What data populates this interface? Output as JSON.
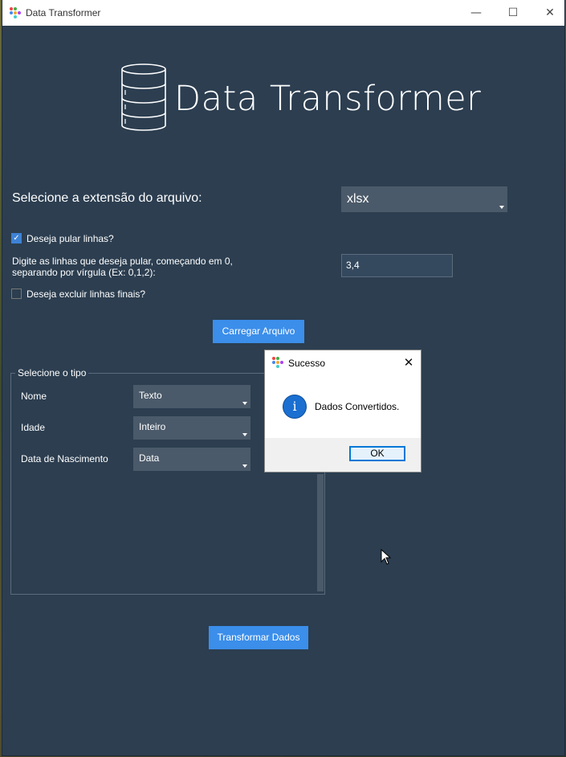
{
  "window": {
    "title": "Data Transformer"
  },
  "header": {
    "app_title": "Data Transformer"
  },
  "extension": {
    "label": "Selecione a extensão do arquivo:",
    "value": "xlsx"
  },
  "skip_lines": {
    "checked": true,
    "label": "Deseja pular linhas?",
    "instruction_line1": "Digite as linhas que deseja pular, começando em 0,",
    "instruction_line2": "separando por vírgula (Ex: 0,1,2):",
    "value": "3,4"
  },
  "exclude_final": {
    "checked": false,
    "label": "Deseja excluir linhas finais?"
  },
  "load_button": "Carregar Arquivo",
  "types_group": {
    "title": "Selecione o tipo",
    "rows": [
      {
        "column": "Nome",
        "type": "Texto"
      },
      {
        "column": "Idade",
        "type": "Inteiro"
      },
      {
        "column": "Data de Nascimento",
        "type": "Data"
      }
    ]
  },
  "transform_button": "Transformar Dados",
  "dialog": {
    "title": "Sucesso",
    "message": "Dados Convertidos.",
    "ok_label": "OK",
    "icon": "info-icon"
  },
  "colors": {
    "background": "#2c3e50",
    "accent": "#3b8eea",
    "combo": "#4b5a6a"
  }
}
